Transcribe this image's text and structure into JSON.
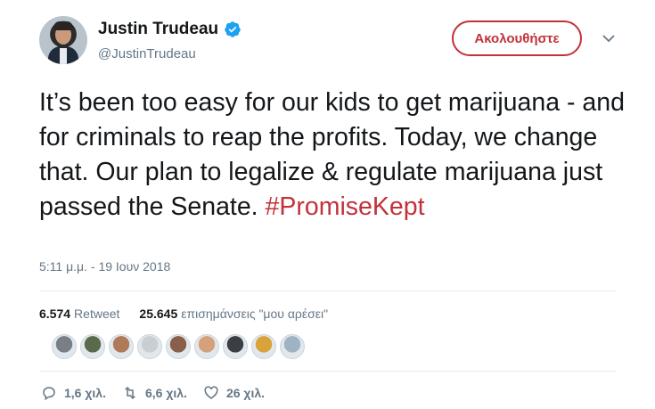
{
  "user": {
    "name": "Justin Trudeau",
    "handle": "@JustinTrudeau",
    "verified": true
  },
  "follow_button": {
    "label": "Ακολουθήστε"
  },
  "tweet": {
    "text": "It’s been too easy for our kids to get marijuana - and for criminals to reap the profits. Today, we change that. Our plan to legalize & regulate marijuana just passed the Senate.",
    "hashtag": "#PromiseKept",
    "timestamp": "5:11 μ.μ. - 19 Ιουν 2018"
  },
  "stats": {
    "retweets_count": "6.574",
    "retweets_label": "Retweet",
    "likes_count": "25.645",
    "likes_label": "επισημάνσεις \"μου αρέσει\""
  },
  "likers": [
    {
      "color": "#7a7f86"
    },
    {
      "color": "#5a6b4c"
    },
    {
      "color": "#b07a5a"
    },
    {
      "color": "#c9ced3"
    },
    {
      "color": "#8a5f4a"
    },
    {
      "color": "#d5a07c"
    },
    {
      "color": "#3b3f45"
    },
    {
      "color": "#d9a23a"
    },
    {
      "color": "#9fb3c2"
    }
  ],
  "actions": {
    "replies": "1,6 χιλ.",
    "retweets": "6,6 χιλ.",
    "likes": "26 χιλ."
  },
  "colors": {
    "accent": "#c2323a",
    "verified": "#1da1f2",
    "muted": "#657786"
  }
}
